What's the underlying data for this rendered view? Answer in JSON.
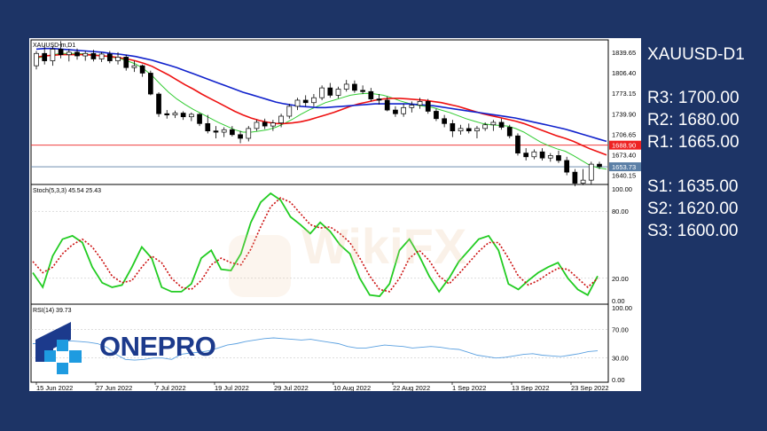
{
  "symbol_title": "XAUUSD-D1",
  "levels": [
    {
      "label": "R3: 1700.00"
    },
    {
      "label": "R2: 1680.00"
    },
    {
      "label": "R1: 1665.00"
    },
    {
      "label": "S1: 1635.00"
    },
    {
      "label": "S2: 1620.00"
    },
    {
      "label": "S3: 1600.00"
    }
  ],
  "logo_text": "ONEPRO",
  "watermark_text": "WikiFX",
  "colors": {
    "background": "#1d3466",
    "ma_fast": "#33cc33",
    "ma_mid": "#ee1111",
    "ma_slow": "#1122cc",
    "stoch_main": "#22cc22",
    "stoch_signal": "#cc1111",
    "rsi_line": "#5aa0e0",
    "resistance_line": "#ee2222",
    "current_line": "#5b7fa6",
    "logo_blue": "#1c3a8c",
    "logo_cyan": "#1e9be0"
  },
  "chart_data": [
    {
      "type": "candlestick",
      "label": "XAUUSD-m,D1",
      "ylim": [
        1625,
        1860
      ],
      "y_ticks": [
        "1839.65",
        "1806.40",
        "1773.15",
        "1739.90",
        "1706.65",
        "1673.40",
        "1640.15"
      ],
      "x_tick_labels": [
        "15 Jun 2022",
        "27 Jun 2022",
        "7 Jul 2022",
        "19 Jul 2022",
        "29 Jul 2022",
        "10 Aug 2022",
        "22 Aug 2022",
        "1 Sep 2022",
        "13 Sep 2022",
        "23 Sep 2022"
      ],
      "horizontal_lines": [
        {
          "value": 1688.9,
          "label": "1688.90"
        },
        {
          "value": 1653.73,
          "label": "1653.73"
        }
      ],
      "candles": [
        {
          "o": 1818,
          "h": 1842,
          "l": 1812,
          "c": 1838
        },
        {
          "o": 1838,
          "h": 1852,
          "l": 1820,
          "c": 1826
        },
        {
          "o": 1826,
          "h": 1850,
          "l": 1818,
          "c": 1845
        },
        {
          "o": 1845,
          "h": 1858,
          "l": 1830,
          "c": 1836
        },
        {
          "o": 1836,
          "h": 1845,
          "l": 1825,
          "c": 1840
        },
        {
          "o": 1840,
          "h": 1846,
          "l": 1828,
          "c": 1834
        },
        {
          "o": 1834,
          "h": 1842,
          "l": 1826,
          "c": 1838
        },
        {
          "o": 1838,
          "h": 1844,
          "l": 1825,
          "c": 1829
        },
        {
          "o": 1829,
          "h": 1840,
          "l": 1824,
          "c": 1837
        },
        {
          "o": 1837,
          "h": 1842,
          "l": 1822,
          "c": 1826
        },
        {
          "o": 1826,
          "h": 1840,
          "l": 1820,
          "c": 1832
        },
        {
          "o": 1832,
          "h": 1836,
          "l": 1810,
          "c": 1815
        },
        {
          "o": 1815,
          "h": 1826,
          "l": 1808,
          "c": 1818
        },
        {
          "o": 1818,
          "h": 1820,
          "l": 1800,
          "c": 1806
        },
        {
          "o": 1806,
          "h": 1810,
          "l": 1770,
          "c": 1772
        },
        {
          "o": 1772,
          "h": 1775,
          "l": 1735,
          "c": 1740
        },
        {
          "o": 1740,
          "h": 1746,
          "l": 1732,
          "c": 1738
        },
        {
          "o": 1738,
          "h": 1745,
          "l": 1733,
          "c": 1741
        },
        {
          "o": 1741,
          "h": 1744,
          "l": 1730,
          "c": 1735
        },
        {
          "o": 1735,
          "h": 1742,
          "l": 1728,
          "c": 1739
        },
        {
          "o": 1739,
          "h": 1741,
          "l": 1720,
          "c": 1724
        },
        {
          "o": 1724,
          "h": 1738,
          "l": 1708,
          "c": 1712
        },
        {
          "o": 1712,
          "h": 1720,
          "l": 1700,
          "c": 1710
        },
        {
          "o": 1710,
          "h": 1718,
          "l": 1702,
          "c": 1714
        },
        {
          "o": 1714,
          "h": 1720,
          "l": 1703,
          "c": 1706
        },
        {
          "o": 1706,
          "h": 1712,
          "l": 1692,
          "c": 1700
        },
        {
          "o": 1700,
          "h": 1720,
          "l": 1695,
          "c": 1716
        },
        {
          "o": 1716,
          "h": 1730,
          "l": 1712,
          "c": 1726
        },
        {
          "o": 1726,
          "h": 1732,
          "l": 1715,
          "c": 1720
        },
        {
          "o": 1720,
          "h": 1730,
          "l": 1712,
          "c": 1725
        },
        {
          "o": 1725,
          "h": 1740,
          "l": 1718,
          "c": 1736
        },
        {
          "o": 1736,
          "h": 1756,
          "l": 1732,
          "c": 1752
        },
        {
          "o": 1752,
          "h": 1766,
          "l": 1746,
          "c": 1762
        },
        {
          "o": 1762,
          "h": 1770,
          "l": 1752,
          "c": 1758
        },
        {
          "o": 1758,
          "h": 1772,
          "l": 1752,
          "c": 1766
        },
        {
          "o": 1766,
          "h": 1786,
          "l": 1762,
          "c": 1782
        },
        {
          "o": 1782,
          "h": 1790,
          "l": 1766,
          "c": 1770
        },
        {
          "o": 1770,
          "h": 1784,
          "l": 1765,
          "c": 1780
        },
        {
          "o": 1780,
          "h": 1795,
          "l": 1776,
          "c": 1788
        },
        {
          "o": 1788,
          "h": 1794,
          "l": 1774,
          "c": 1778
        },
        {
          "o": 1778,
          "h": 1786,
          "l": 1772,
          "c": 1776
        },
        {
          "o": 1776,
          "h": 1782,
          "l": 1760,
          "c": 1764
        },
        {
          "o": 1764,
          "h": 1772,
          "l": 1755,
          "c": 1762
        },
        {
          "o": 1762,
          "h": 1768,
          "l": 1744,
          "c": 1746
        },
        {
          "o": 1746,
          "h": 1752,
          "l": 1735,
          "c": 1740
        },
        {
          "o": 1740,
          "h": 1756,
          "l": 1735,
          "c": 1750
        },
        {
          "o": 1750,
          "h": 1760,
          "l": 1742,
          "c": 1754
        },
        {
          "o": 1754,
          "h": 1766,
          "l": 1748,
          "c": 1760
        },
        {
          "o": 1760,
          "h": 1764,
          "l": 1740,
          "c": 1744
        },
        {
          "o": 1744,
          "h": 1748,
          "l": 1728,
          "c": 1732
        },
        {
          "o": 1732,
          "h": 1738,
          "l": 1718,
          "c": 1724
        },
        {
          "o": 1724,
          "h": 1730,
          "l": 1702,
          "c": 1712
        },
        {
          "o": 1712,
          "h": 1722,
          "l": 1706,
          "c": 1716
        },
        {
          "o": 1716,
          "h": 1724,
          "l": 1708,
          "c": 1712
        },
        {
          "o": 1712,
          "h": 1720,
          "l": 1700,
          "c": 1716
        },
        {
          "o": 1716,
          "h": 1726,
          "l": 1712,
          "c": 1722
        },
        {
          "o": 1722,
          "h": 1730,
          "l": 1712,
          "c": 1726
        },
        {
          "o": 1726,
          "h": 1732,
          "l": 1714,
          "c": 1718
        },
        {
          "o": 1718,
          "h": 1722,
          "l": 1700,
          "c": 1704
        },
        {
          "o": 1704,
          "h": 1708,
          "l": 1672,
          "c": 1676
        },
        {
          "o": 1676,
          "h": 1684,
          "l": 1664,
          "c": 1670
        },
        {
          "o": 1670,
          "h": 1682,
          "l": 1666,
          "c": 1678
        },
        {
          "o": 1678,
          "h": 1684,
          "l": 1664,
          "c": 1668
        },
        {
          "o": 1668,
          "h": 1676,
          "l": 1662,
          "c": 1672
        },
        {
          "o": 1672,
          "h": 1680,
          "l": 1660,
          "c": 1664
        },
        {
          "o": 1664,
          "h": 1670,
          "l": 1640,
          "c": 1645
        },
        {
          "o": 1645,
          "h": 1650,
          "l": 1622,
          "c": 1627
        },
        {
          "o": 1627,
          "h": 1650,
          "l": 1624,
          "c": 1632
        },
        {
          "o": 1632,
          "h": 1662,
          "l": 1625,
          "c": 1658
        },
        {
          "o": 1658,
          "h": 1662,
          "l": 1650,
          "c": 1654
        }
      ],
      "series": [
        {
          "name": "fast_ma",
          "values": [
            1830,
            1833,
            1836,
            1838,
            1838,
            1838,
            1837,
            1836,
            1834,
            1832,
            1830,
            1826,
            1821,
            1813,
            1802,
            1788,
            1775,
            1764,
            1755,
            1747,
            1740,
            1733,
            1726,
            1720,
            1714,
            1710,
            1710,
            1712,
            1714,
            1718,
            1724,
            1731,
            1739,
            1746,
            1752,
            1758,
            1762,
            1766,
            1770,
            1772,
            1773,
            1772,
            1770,
            1766,
            1761,
            1757,
            1754,
            1752,
            1750,
            1746,
            1742,
            1737,
            1732,
            1728,
            1724,
            1722,
            1721,
            1720,
            1716,
            1710,
            1702,
            1694,
            1688,
            1683,
            1679,
            1672,
            1664,
            1656,
            1652,
            1650
          ]
        },
        {
          "name": "mid_ma",
          "values": [
            1832,
            1834,
            1835,
            1836,
            1836,
            1836,
            1836,
            1835,
            1834,
            1833,
            1831,
            1829,
            1826,
            1822,
            1817,
            1810,
            1803,
            1795,
            1787,
            1780,
            1772,
            1765,
            1758,
            1751,
            1744,
            1738,
            1733,
            1729,
            1726,
            1724,
            1724,
            1725,
            1727,
            1730,
            1734,
            1738,
            1742,
            1747,
            1752,
            1756,
            1759,
            1762,
            1764,
            1765,
            1765,
            1764,
            1763,
            1762,
            1760,
            1758,
            1755,
            1752,
            1748,
            1744,
            1740,
            1737,
            1734,
            1731,
            1728,
            1724,
            1719,
            1714,
            1709,
            1704,
            1700,
            1695,
            1689,
            1683,
            1678,
            1673
          ]
        },
        {
          "name": "slow_ma",
          "values": [
            1845,
            1846,
            1846,
            1845,
            1844,
            1843,
            1842,
            1841,
            1840,
            1838,
            1837,
            1835,
            1833,
            1830,
            1827,
            1823,
            1819,
            1815,
            1810,
            1805,
            1800,
            1795,
            1790,
            1785,
            1780,
            1775,
            1771,
            1767,
            1763,
            1759,
            1756,
            1754,
            1752,
            1751,
            1750,
            1750,
            1751,
            1752,
            1753,
            1754,
            1755,
            1756,
            1756,
            1756,
            1756,
            1756,
            1755,
            1754,
            1753,
            1751,
            1749,
            1747,
            1745,
            1743,
            1741,
            1739,
            1737,
            1735,
            1733,
            1730,
            1727,
            1724,
            1721,
            1718,
            1715,
            1711,
            1707,
            1703,
            1699,
            1695
          ]
        }
      ]
    },
    {
      "type": "line",
      "label": "Stoch(5,3,3) 45.54 25.43",
      "ylim": [
        0,
        100
      ],
      "y_ticks": [
        "100.00",
        "80.00",
        "20.00",
        "0.00"
      ],
      "series": [
        {
          "name": "main",
          "values": [
            25,
            12,
            40,
            55,
            58,
            52,
            30,
            16,
            12,
            14,
            30,
            48,
            38,
            12,
            8,
            8,
            15,
            38,
            45,
            28,
            27,
            42,
            70,
            88,
            96,
            90,
            75,
            68,
            60,
            70,
            62,
            50,
            42,
            20,
            5,
            4,
            15,
            45,
            55,
            40,
            22,
            8,
            20,
            35,
            45,
            55,
            58,
            45,
            15,
            10,
            18,
            25,
            30,
            34,
            20,
            10,
            5,
            22
          ]
        },
        {
          "name": "signal",
          "values": [
            35,
            25,
            30,
            42,
            50,
            55,
            48,
            36,
            22,
            16,
            18,
            30,
            40,
            34,
            20,
            12,
            10,
            18,
            32,
            38,
            34,
            32,
            46,
            66,
            84,
            92,
            88,
            78,
            68,
            65,
            66,
            60,
            52,
            38,
            22,
            10,
            8,
            20,
            38,
            45,
            36,
            22,
            15,
            24,
            34,
            44,
            52,
            52,
            38,
            22,
            14,
            18,
            24,
            29,
            28,
            20,
            12,
            20
          ]
        }
      ]
    },
    {
      "type": "line",
      "label": "RSI(14) 39.73",
      "ylim": [
        0,
        100
      ],
      "y_ticks": [
        "100.00",
        "70.00",
        "30.00",
        "0.00"
      ],
      "series": [
        {
          "name": "rsi",
          "values": [
            50,
            50,
            52,
            53,
            54,
            53,
            52,
            50,
            45,
            35,
            28,
            27,
            28,
            30,
            30,
            28,
            35,
            37,
            38,
            40,
            44,
            48,
            50,
            53,
            55,
            57,
            58,
            57,
            56,
            55,
            56,
            54,
            52,
            50,
            46,
            44,
            44,
            46,
            48,
            47,
            46,
            44,
            45,
            46,
            45,
            43,
            42,
            38,
            34,
            32,
            30,
            31,
            33,
            35,
            36,
            34,
            33,
            32,
            34,
            36,
            39,
            40
          ]
        }
      ]
    }
  ]
}
